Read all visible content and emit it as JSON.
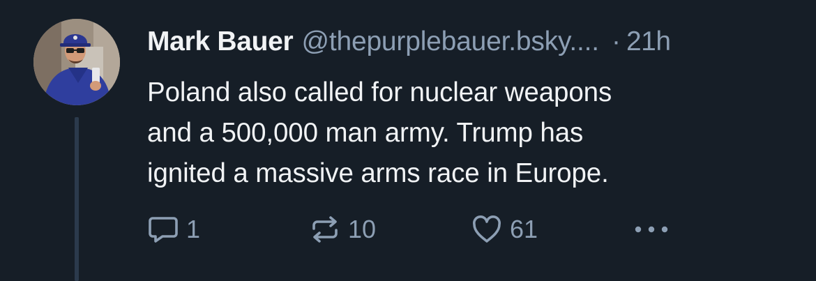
{
  "post": {
    "author": {
      "display_name": "Mark Bauer",
      "handle": "@thepurplebauer.bsky....",
      "avatar_icon": "user-avatar-photo"
    },
    "separator": "·",
    "timestamp": "21h",
    "text_lines": [
      "Poland also called for nuclear weapons",
      "and a 500,000 man army. Trump has",
      "ignited a massive arms race in Europe."
    ],
    "actions": {
      "reply": {
        "icon": "speech-bubble-icon",
        "count": "1"
      },
      "repost": {
        "icon": "repost-arrows-icon",
        "count": "10"
      },
      "like": {
        "icon": "heart-icon",
        "count": "61"
      },
      "more": {
        "icon": "ellipsis-icon"
      }
    }
  },
  "colors": {
    "background": "#161e27",
    "primary_text": "#f1f3f5",
    "secondary_text": "#8d9fb4",
    "thread_line": "#2b3a4c"
  }
}
